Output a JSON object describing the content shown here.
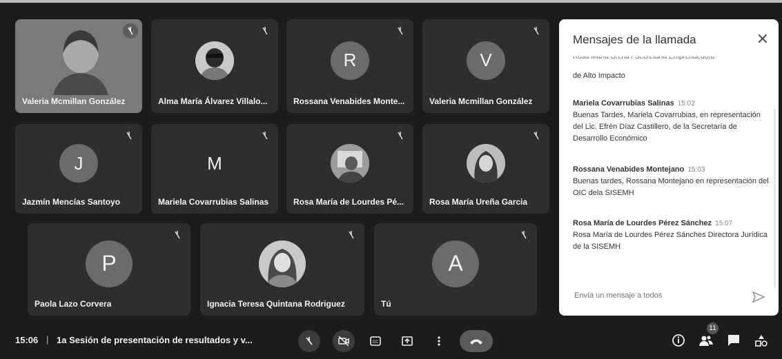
{
  "participants": [
    {
      "name": "Valeria Mcmillan González",
      "initial": "",
      "kind": "video"
    },
    {
      "name": "Alma María Álvarez Villalo...",
      "initial": "",
      "kind": "photo"
    },
    {
      "name": "Rossana Venabides Monte...",
      "initial": "R",
      "kind": "letter"
    },
    {
      "name": "Valeria Mcmillan González",
      "initial": "V",
      "kind": "letter"
    },
    {
      "name": "Jazmín Mencías Santoyo",
      "initial": "J",
      "kind": "letter"
    },
    {
      "name": "Mariela Covarrubias Salinas",
      "initial": "M",
      "kind": "text"
    },
    {
      "name": "Rosa María de Lourdes Pé...",
      "initial": "",
      "kind": "photo"
    },
    {
      "name": "Rosa María Ureña Garcia",
      "initial": "",
      "kind": "photo"
    },
    {
      "name": "Paola Lazo Corvera",
      "initial": "P",
      "kind": "letter"
    },
    {
      "name": "Ignacia Teresa Quintana Rodriguez",
      "initial": "",
      "kind": "photo"
    },
    {
      "name": "Tú",
      "initial": "A",
      "kind": "letter"
    }
  ],
  "chat": {
    "title": "Mensajes de la llamada",
    "close_icon": "close-icon",
    "cut_text": "Rosa María Ureña / Secretaría Emprendedora",
    "cont_text": "de Alto Impacto",
    "messages": [
      {
        "sender": "Mariela Covarrubias Salinas",
        "time": "15:02",
        "text": "Buenas Tardes, Mariela Covarrubias, en representación del Lic. Efrén Díaz Castillero, de la Secretaría de Desarrollo Económico"
      },
      {
        "sender": "Rossana Venabides Montejano",
        "time": "15:03",
        "text": "Buenas tardes, Rossana  Montejano en representación del OIC dela SISEMH"
      },
      {
        "sender": "Rosa María de Lourdes Pérez Sánchez",
        "time": "15:07",
        "text": "Rosa María de Lourdes Pérez Sánches Directora Jurídica de la SISEMH"
      }
    ],
    "input_placeholder": "Envía un mensaje a todos"
  },
  "bottom_bar": {
    "time": "15:06",
    "separator": "|",
    "meeting_title": "1a Sesión de presentación de resultados y v...",
    "people_count": "11",
    "icons": [
      "mic-off-icon",
      "camera-off-icon",
      "captions-icon",
      "present-icon",
      "more-icon",
      "end-call-icon",
      "info-icon",
      "people-icon",
      "chat-icon",
      "activities-icon"
    ]
  },
  "colors": {
    "background": "#1c1c1c",
    "tile": "#2e2e2e",
    "avatar": "#6b6b6b",
    "panel": "#ffffff"
  }
}
